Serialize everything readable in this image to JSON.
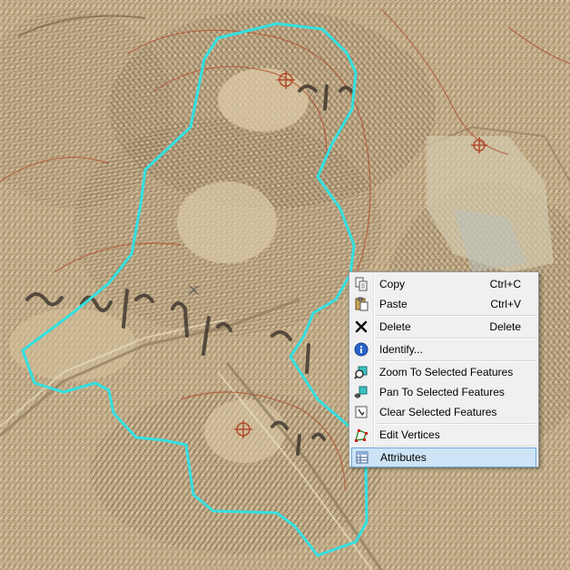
{
  "context_menu": {
    "items": [
      {
        "label": "Copy",
        "shortcut": "Ctrl+C",
        "icon": "copy-icon"
      },
      {
        "label": "Paste",
        "shortcut": "Ctrl+V",
        "icon": "paste-icon"
      },
      {
        "label": "Delete",
        "shortcut": "Delete",
        "icon": "delete-x-icon"
      },
      {
        "label": "Identify...",
        "shortcut": "",
        "icon": "identify-info-icon"
      },
      {
        "label": "Zoom To Selected Features",
        "shortcut": "",
        "icon": "zoom-to-selected-icon"
      },
      {
        "label": "Pan To Selected Features",
        "shortcut": "",
        "icon": "pan-to-selected-icon"
      },
      {
        "label": "Clear Selected Features",
        "shortcut": "",
        "icon": "clear-selection-icon"
      },
      {
        "label": "Edit Vertices",
        "shortcut": "",
        "icon": "edit-vertices-icon"
      },
      {
        "label": "Attributes",
        "shortcut": "",
        "icon": "attributes-table-icon",
        "highlighted": true
      }
    ]
  },
  "colors": {
    "map_base": "#c9b48f",
    "hachure": "#6b5540",
    "contour": "#b04a2a",
    "polygon_outline": "#33e0e0",
    "menu_background": "#f0f0f0",
    "menu_highlight": "#cde4f7",
    "menu_highlight_border": "#6aa4d8"
  }
}
